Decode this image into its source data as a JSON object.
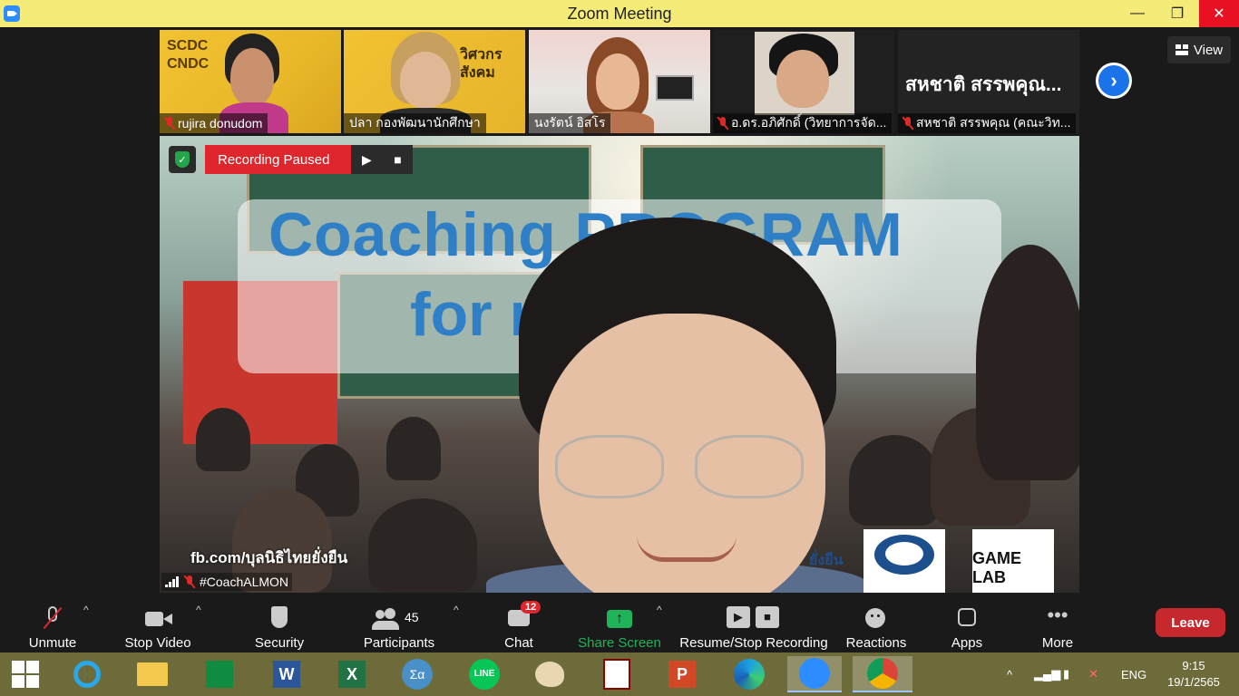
{
  "window": {
    "title": "Zoom Meeting",
    "minimize": "—",
    "maximize": "❐",
    "close": "✕"
  },
  "gallery": {
    "view_label": "View",
    "participants": [
      {
        "name": "rujira donudom",
        "muted": true
      },
      {
        "name": "ปลา กองพัฒนานักศึกษา",
        "muted": false
      },
      {
        "name": "นงรัตน์ อิสโร",
        "muted": false
      },
      {
        "name": "อ.ดร.อภิศักดิ์ (วิทยาการจัด...",
        "muted": true
      },
      {
        "name": "สหชาติ สรรพคุณ (คณะวิท...",
        "muted": true,
        "display_name": "สหชาติ สรรพคุณ..."
      }
    ],
    "tile1_badge": "SCDC\nCNDC",
    "tile2_badge": "วิศวกร\nสังคม"
  },
  "main_video": {
    "recording_label": "Recording Paused",
    "slide_line1": "Coaching PROGRAM",
    "slide_line2": "for          r",
    "overlay_fb": "fb.com/บุลนิธิไทยยั่งยืน",
    "self_name": "#CoachALMON",
    "logo_game": "GAME LAB",
    "logo_partial": "ยั่งยืน"
  },
  "toolbar": {
    "unmute": "Unmute",
    "stop_video": "Stop Video",
    "security": "Security",
    "participants": "Participants",
    "participants_count": "45",
    "chat": "Chat",
    "chat_badge": "12",
    "share_screen": "Share Screen",
    "record": "Resume/Stop Recording",
    "reactions": "Reactions",
    "apps": "Apps",
    "more": "More",
    "leave": "Leave"
  },
  "taskbar": {
    "lang": "ENG",
    "time": "9:15",
    "date": "19/1/2565"
  }
}
